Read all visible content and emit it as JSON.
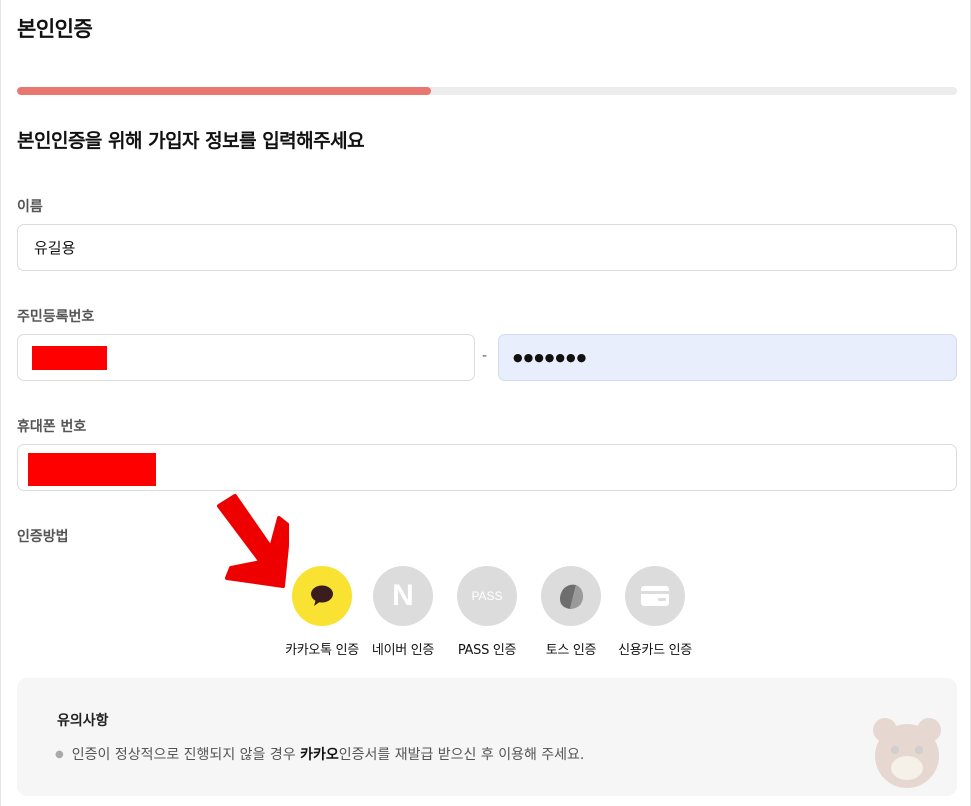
{
  "page": {
    "title": "본인인증",
    "progress": 0.44,
    "heading": "본인인증을 위해 가입자 정보를 입력해주세요"
  },
  "form": {
    "name_label": "이름",
    "name_value": "유길용",
    "rrn_label": "주민등록번호",
    "rrn_separator": "-",
    "rrn_back_masked": "●●●●●●●",
    "phone_label": "휴대폰 번호",
    "method_label": "인증방법"
  },
  "methods": [
    {
      "id": "kakao",
      "label": "카카오톡 인증",
      "icon": "kakao-talk-icon",
      "color": "#f9e231"
    },
    {
      "id": "naver",
      "label": "네이버 인증",
      "icon": "naver-icon",
      "icon_text": "N",
      "color": "#dcdcdc"
    },
    {
      "id": "pass",
      "label": "PASS 인증",
      "icon": "pass-icon",
      "icon_text": "PASS",
      "color": "#dcdcdc"
    },
    {
      "id": "toss",
      "label": "토스 인증",
      "icon": "toss-icon",
      "color": "#dcdcdc"
    },
    {
      "id": "card",
      "label": "신용카드 인증",
      "icon": "credit-card-icon",
      "color": "#dcdcdc"
    }
  ],
  "notice": {
    "title": "유의사항",
    "text_before": "인증이 정상적으로 진행되지 않을 경우",
    "text_bold": "카카오",
    "text_after": "인증서를 재발급 받으신 후 이용해 주세요."
  },
  "colors": {
    "progress_fill": "#e8776f",
    "progress_track": "#ececec",
    "redaction": "#ff0000",
    "arrow": "#ee0000"
  }
}
